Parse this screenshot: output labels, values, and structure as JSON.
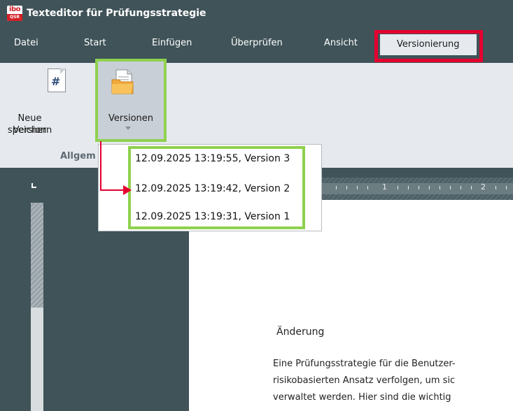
{
  "window": {
    "title": "Texteditor für Prüfungsstrategie",
    "logo_top": "ibo",
    "logo_bottom": "QSR"
  },
  "menu": {
    "items": [
      "Datei",
      "Start",
      "Einfügen",
      "Überprüfen",
      "Ansicht",
      "Versionierung"
    ],
    "active": "Versionierung"
  },
  "ribbon": {
    "new_version_label_line1": "Neue Version",
    "new_version_label_line2": "speichern",
    "versions_label": "Versionen",
    "group_label": "Allgem",
    "new_version_icon": "hash-document-icon",
    "versions_icon": "folder-document-icon"
  },
  "dropdown": {
    "versions": [
      "12.09.2025 13:19:55, Version 3",
      "12.09.2025 13:19:42, Version 2",
      "12.09.2025 13:19:31, Version 1"
    ]
  },
  "ruler": {
    "corner_mark": "L",
    "numbers": [
      "1",
      "2"
    ]
  },
  "document": {
    "heading": "Änderung",
    "lines": [
      "Eine Prüfungsstrategie für die Benutzer-",
      "risikobasierten Ansatz verfolgen, um sic",
      "verwaltet werden. Hier sind die wichtig"
    ]
  },
  "colors": {
    "chrome": "#3f5358",
    "ribbon": "#e6eaef",
    "highlight_red": "#e5002f",
    "highlight_green": "#8fd14f"
  }
}
